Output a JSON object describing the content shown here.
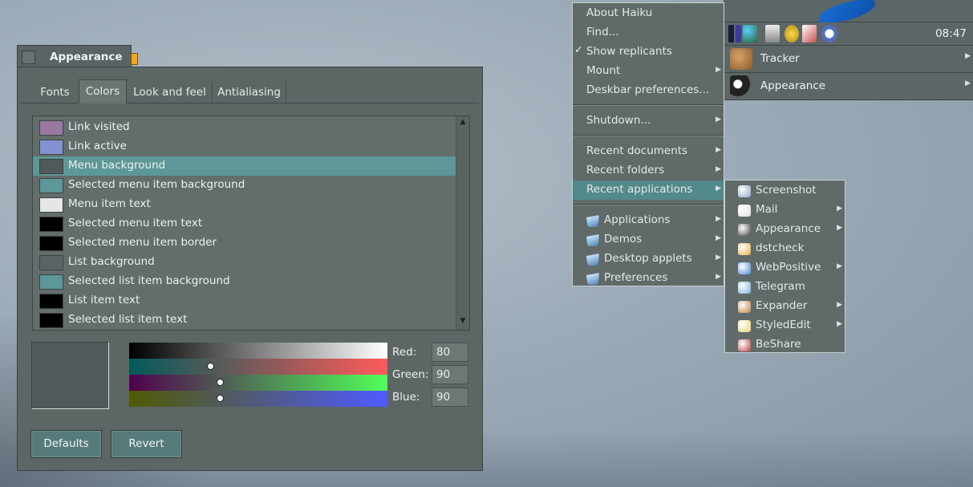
{
  "window": {
    "title": "Appearance",
    "tabs": [
      "Fonts",
      "Colors",
      "Look and feel",
      "Antialiasing"
    ],
    "active_tab": "Colors",
    "color_items": [
      {
        "label": "Link visited",
        "color": "#9b78a1"
      },
      {
        "label": "Link active",
        "color": "#8393d1"
      },
      {
        "label": "Menu background",
        "color": "#505a5a"
      },
      {
        "label": "Selected menu item background",
        "color": "#5d9797"
      },
      {
        "label": "Menu item text",
        "color": "#e6e6e6"
      },
      {
        "label": "Selected menu item text",
        "color": "#000000"
      },
      {
        "label": "Selected menu item border",
        "color": "#000000"
      },
      {
        "label": "List background",
        "color": "#5a6464"
      },
      {
        "label": "Selected list item background",
        "color": "#5d9797"
      },
      {
        "label": "List item text",
        "color": "#000000"
      },
      {
        "label": "Selected list item text",
        "color": "#000000"
      }
    ],
    "selected_item": "Menu background",
    "rgb": {
      "red_label": "Red:",
      "red": "80",
      "green_label": "Green:",
      "green": "90",
      "blue_label": "Blue:",
      "blue": "90"
    },
    "buttons": {
      "defaults": "Defaults",
      "revert": "Revert"
    }
  },
  "deskbar": {
    "clock": "08:47",
    "apps": [
      {
        "label": "Tracker",
        "icon": "tracker-icon"
      },
      {
        "label": "Appearance",
        "icon": "appearance-icon"
      }
    ],
    "tray_icons": [
      "process-controller-icon",
      "network-icon",
      "media-icon",
      "power-icon",
      "mail-icon",
      "screenshot-icon",
      "search-icon"
    ]
  },
  "leaf_menu": {
    "group1": [
      "About Haiku",
      "Find...",
      "Show replicants",
      "Mount",
      "Deskbar preferences..."
    ],
    "checked": "Show replicants",
    "group2": [
      "Shutdown..."
    ],
    "group3": [
      "Recent documents",
      "Recent folders",
      "Recent applications"
    ],
    "highlighted": "Recent applications",
    "group4": [
      "Applications",
      "Demos",
      "Desktop applets",
      "Preferences"
    ]
  },
  "recent_apps_menu": {
    "items": [
      {
        "label": "Screenshot",
        "icon": "screenshot-icon",
        "submenu": false
      },
      {
        "label": "Mail",
        "icon": "mail-icon",
        "submenu": true
      },
      {
        "label": "Appearance",
        "icon": "appearance-icon",
        "submenu": true
      },
      {
        "label": "dstcheck",
        "icon": "dstcheck-icon",
        "submenu": false
      },
      {
        "label": "WebPositive",
        "icon": "webpositive-icon",
        "submenu": true
      },
      {
        "label": "Telegram",
        "icon": "telegram-icon",
        "submenu": false
      },
      {
        "label": "Expander",
        "icon": "expander-icon",
        "submenu": true
      },
      {
        "label": "StyledEdit",
        "icon": "stylededit-icon",
        "submenu": true
      },
      {
        "label": "BeShare",
        "icon": "beshare-icon",
        "submenu": false
      }
    ]
  }
}
